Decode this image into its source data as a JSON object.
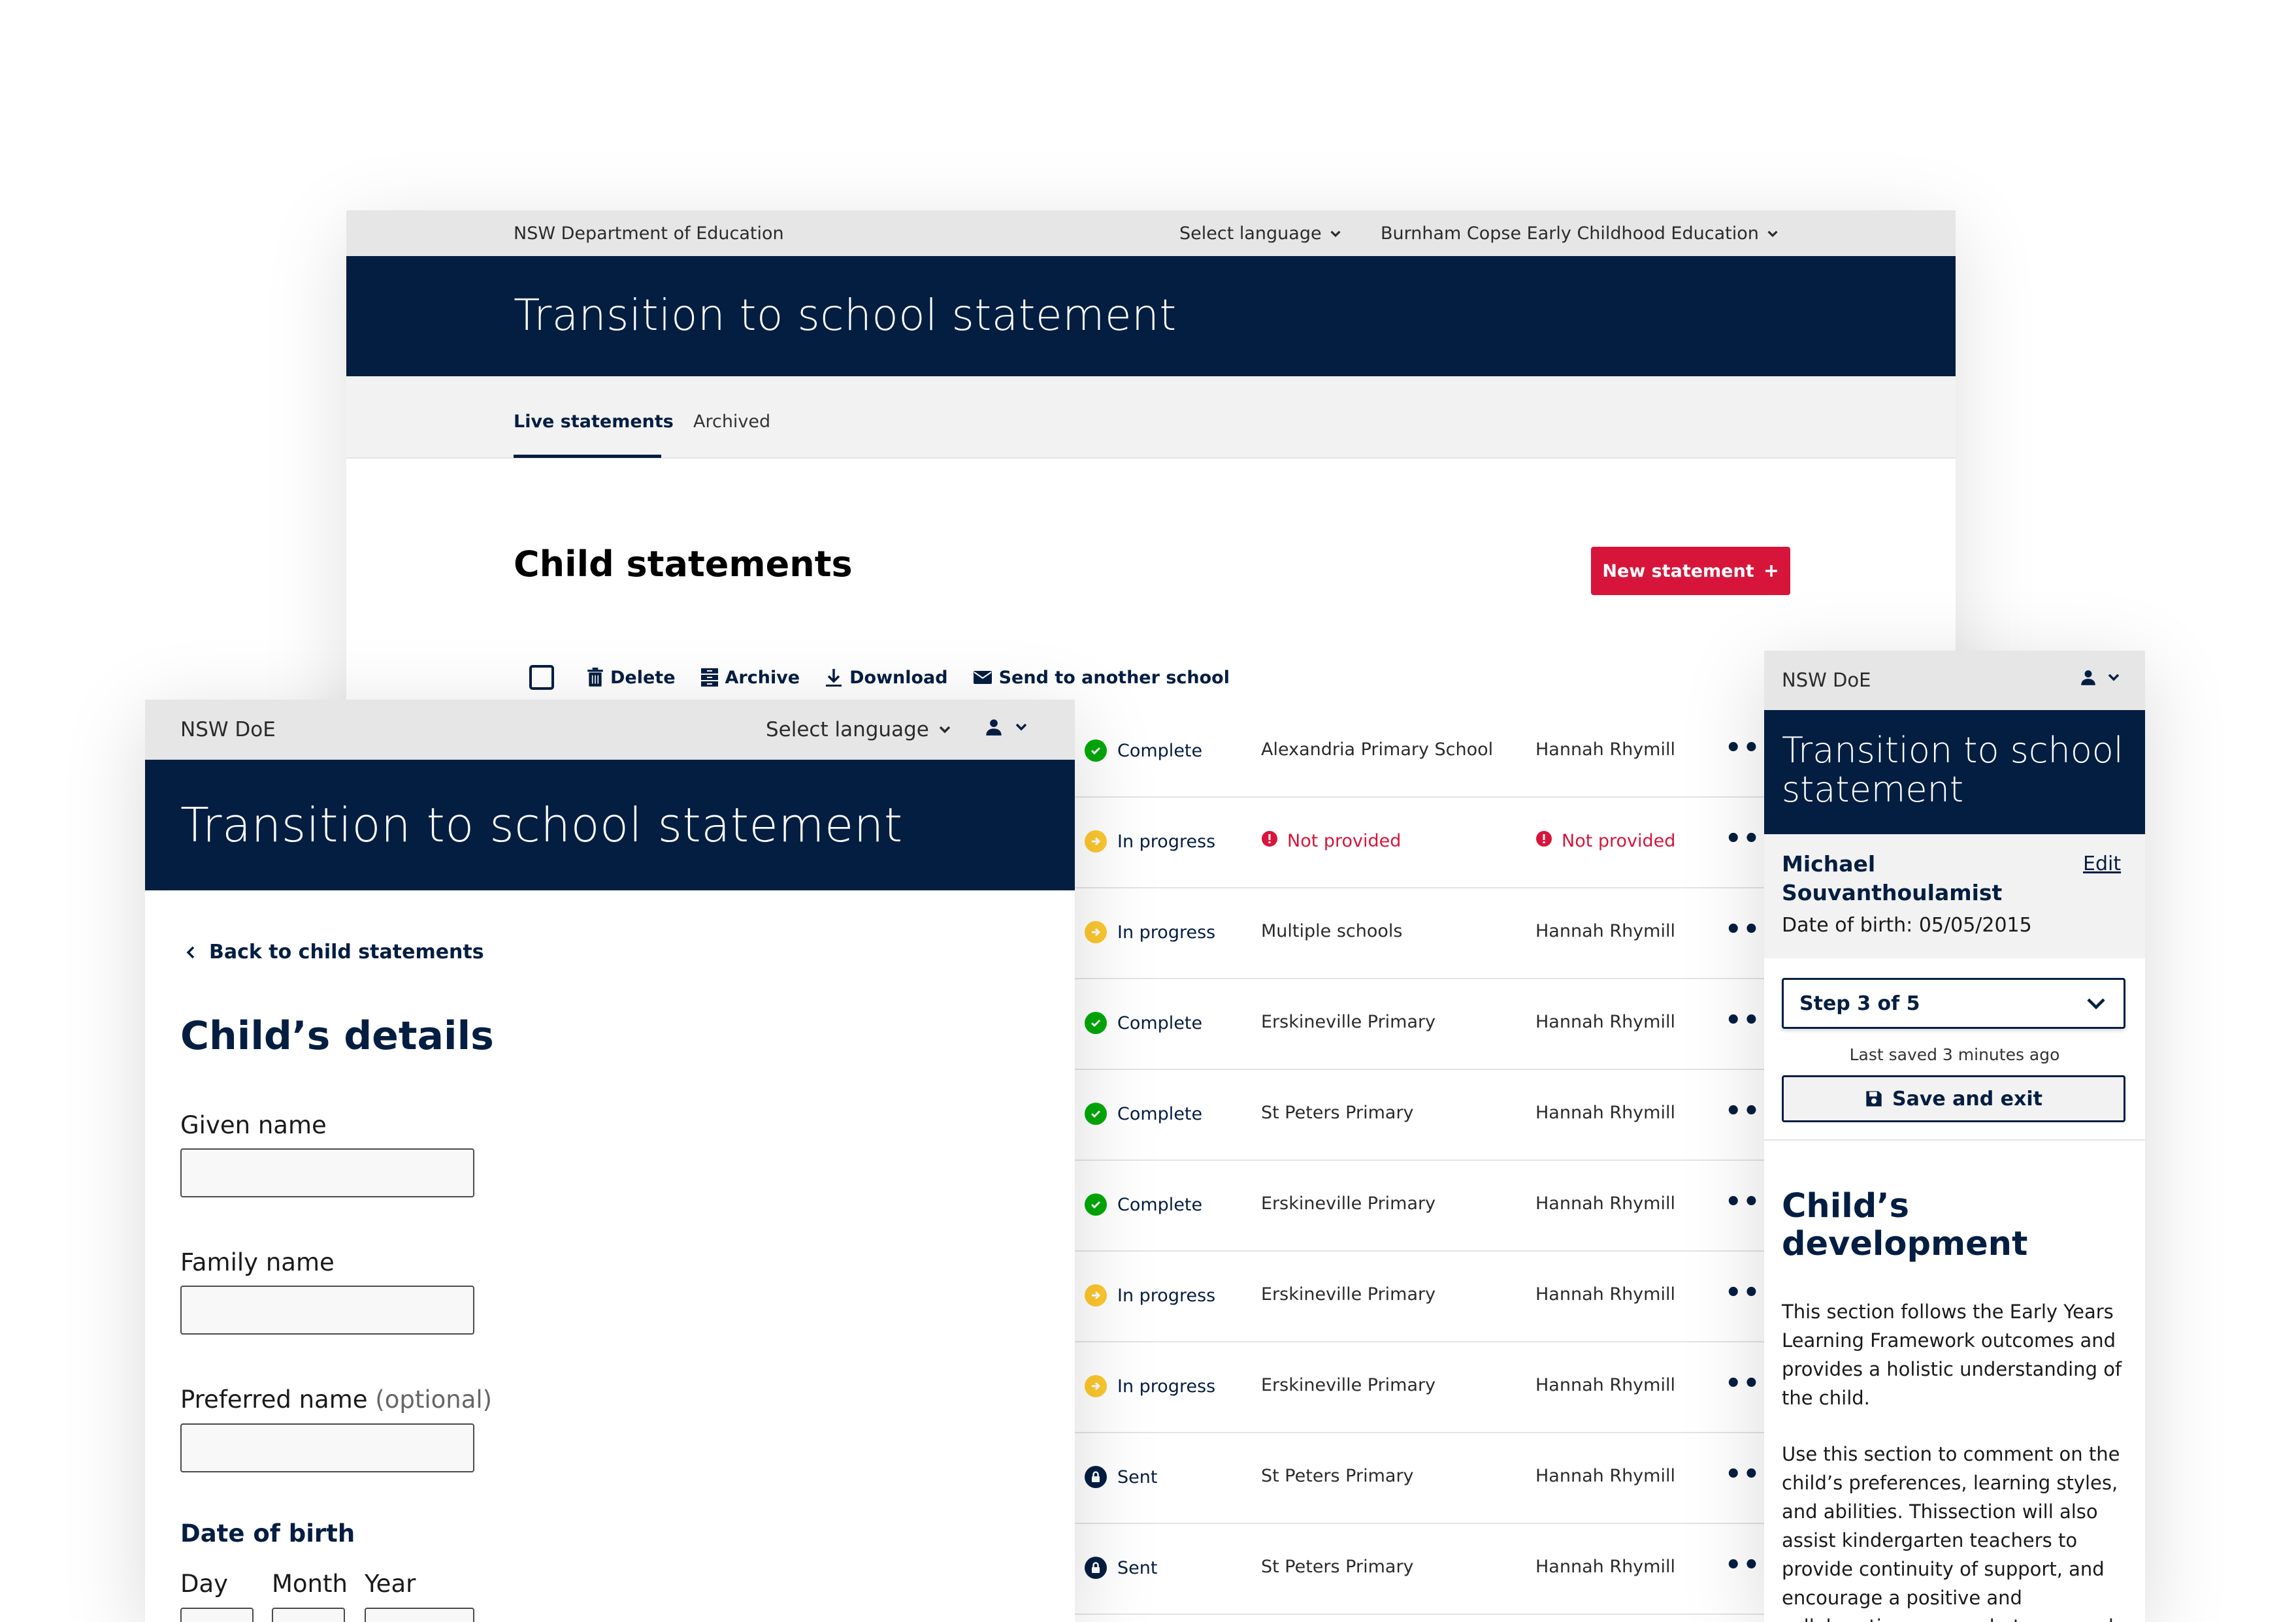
{
  "back_window": {
    "utility": {
      "org": "NSW Department of Education",
      "language": "Select language",
      "school": "Burnham Copse Early Childhood Education"
    },
    "title": "Transition to school statement",
    "tabs": [
      {
        "label": "Live statements",
        "active": true
      },
      {
        "label": "Archived",
        "active": false
      }
    ],
    "heading": "Child statements",
    "new_button": "New statement",
    "actions": [
      {
        "label": "Delete",
        "icon": "trash-icon"
      },
      {
        "label": "Archive",
        "icon": "archive-icon"
      },
      {
        "label": "Download",
        "icon": "download-icon"
      },
      {
        "label": "Send to another school",
        "icon": "mail-icon"
      }
    ],
    "rows": [
      {
        "status": "Complete",
        "school": "Alexandria Primary School",
        "owner": "Hannah Rhymill",
        "school_missing": false,
        "owner_missing": false
      },
      {
        "status": "In progress",
        "school": "Not provided",
        "owner": "Not provided",
        "school_missing": true,
        "owner_missing": true
      },
      {
        "status": "In progress",
        "school": "Multiple schools",
        "owner": "Hannah Rhymill",
        "school_missing": false,
        "owner_missing": false
      },
      {
        "status": "Complete",
        "school": "Erskineville Primary",
        "owner": "Hannah Rhymill",
        "school_missing": false,
        "owner_missing": false
      },
      {
        "status": "Complete",
        "school": "St Peters Primary",
        "owner": "Hannah Rhymill",
        "school_missing": false,
        "owner_missing": false
      },
      {
        "status": "Complete",
        "school": "Erskineville Primary",
        "owner": "Hannah Rhymill",
        "school_missing": false,
        "owner_missing": false
      },
      {
        "status": "In progress",
        "school": "Erskineville Primary",
        "owner": "Hannah Rhymill",
        "school_missing": false,
        "owner_missing": false
      },
      {
        "status": "In progress",
        "school": "Erskineville Primary",
        "owner": "Hannah Rhymill",
        "school_missing": false,
        "owner_missing": false
      },
      {
        "status": "Sent",
        "school": "St Peters Primary",
        "owner": "Hannah Rhymill",
        "school_missing": false,
        "owner_missing": false
      },
      {
        "status": "Sent",
        "school": "St Peters Primary",
        "owner": "Hannah Rhymill",
        "school_missing": false,
        "owner_missing": false
      }
    ],
    "more_label": "•••"
  },
  "left_window": {
    "utility": {
      "org": "NSW DoE",
      "language": "Select language"
    },
    "title": "Transition to school statement",
    "back_link": "Back to child statements",
    "heading": "Child’s details",
    "given_name_label": "Given name",
    "given_name_value": "",
    "family_name_label": "Family name",
    "family_name_value": "",
    "preferred_name_label": "Preferred name",
    "preferred_name_optional": "(optional)",
    "preferred_name_value": "",
    "dob_label": "Date of birth",
    "day_label": "Day",
    "month_label": "Month",
    "year_label": "Year"
  },
  "right_window": {
    "utility": {
      "org": "NSW DoE"
    },
    "title": "Transition to school statement",
    "child_name": "Michael Souvanthoulamist",
    "edit": "Edit",
    "dob": "Date of birth: 05/05/2015",
    "step": "Step 3 of 5",
    "last_saved": "Last saved 3 minutes ago",
    "save_exit": "Save and exit",
    "heading": "Child’s development",
    "para1": "This section follows the Early Years Learning Framework outcomes and provides a holistic understanding of the child.",
    "para2": "Use this section to comment on the child’s preferences, learning styles, and abilities. Thissection will also assist kindergarten teachers to provide continuity of support, and encourage a positive and collaborative process between early"
  },
  "colors": {
    "navy": "#041e42",
    "red": "#d7153a",
    "complete": "#00a908",
    "in_progress": "#fdc72f",
    "grey": "#e6e6e6"
  },
  "status_icons": {
    "Complete": "check-circle-icon",
    "In progress": "arrow-circle-icon",
    "Sent": "lock-circle-icon"
  }
}
